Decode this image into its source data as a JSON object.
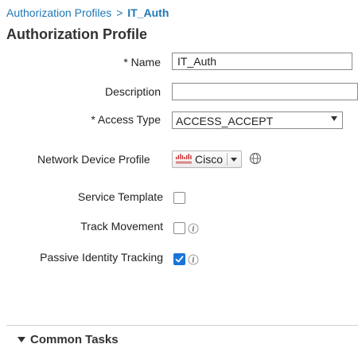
{
  "breadcrumb": {
    "parent": "Authorization Profiles",
    "separator": ">",
    "current": "IT_Auth"
  },
  "page": {
    "title": "Authorization Profile"
  },
  "form": {
    "name": {
      "label": "* Name",
      "value": "IT_Auth"
    },
    "description": {
      "label": "Description",
      "value": ""
    },
    "access_type": {
      "label": "* Access Type",
      "value": "ACCESS_ACCEPT"
    },
    "network_device_profile": {
      "label": "Network Device Profile",
      "value": "Cisco",
      "logo_icon": "cisco-logo-icon",
      "extra_icon": "globe-icon"
    },
    "service_template": {
      "label": "Service Template",
      "checked": false
    },
    "track_movement": {
      "label": "Track Movement",
      "checked": false,
      "info_icon": "info-icon"
    },
    "passive_identity_tracking": {
      "label": "Passive Identity Tracking",
      "checked": true,
      "info_icon": "info-icon"
    }
  },
  "sections": {
    "common_tasks": {
      "label": "Common Tasks",
      "icon": "chevron-down-icon"
    }
  },
  "colors": {
    "link": "#1f78b4",
    "checkbox_checked": "#1a73d9",
    "cisco_logo": "#c62d2d"
  }
}
